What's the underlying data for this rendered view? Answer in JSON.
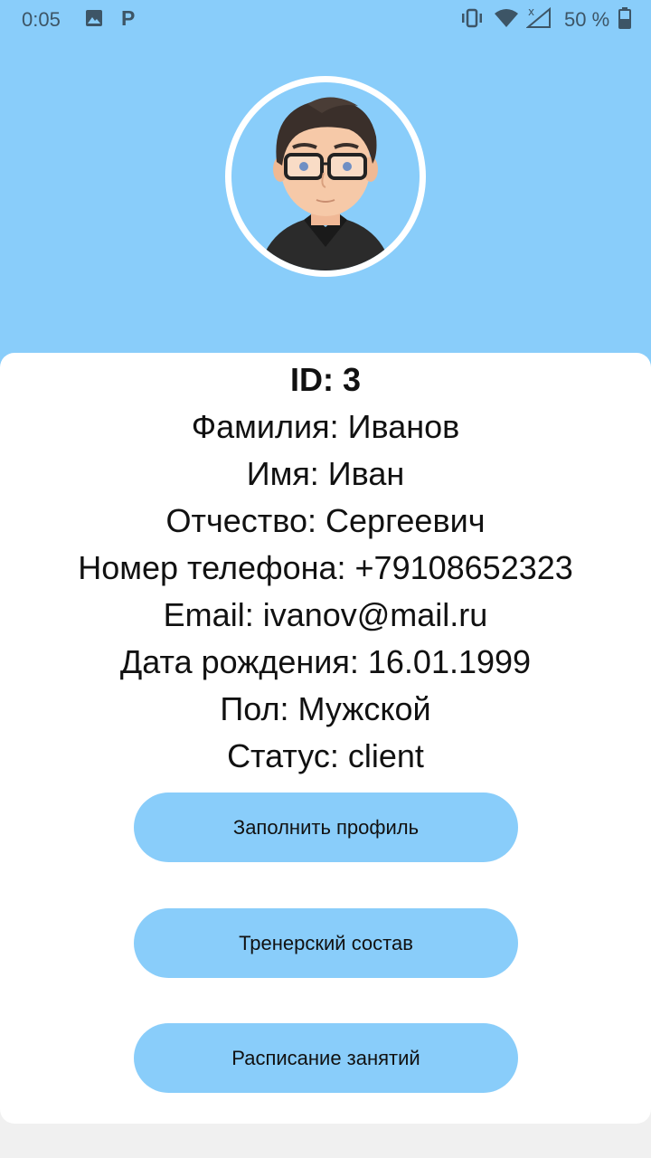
{
  "status_bar": {
    "time": "0:05",
    "battery_text": "50 %",
    "icons": [
      "image-icon",
      "p-icon",
      "vibrate-icon",
      "wifi-icon",
      "signal-icon",
      "battery-icon"
    ]
  },
  "colors": {
    "accent": "#89cdfa",
    "card": "#ffffff",
    "text": "#111111"
  },
  "profile": {
    "id": "ID: 3",
    "last_name": "Фамилия: Иванов",
    "first_name": "Имя: Иван",
    "patronymic": "Отчество: Сергеевич",
    "phone": "Номер телефона: +79108652323",
    "email": "Email: ivanov@mail.ru",
    "birth_date": "Дата рождения: 16.01.1999",
    "gender": "Пол: Мужской",
    "status": "Статус: client"
  },
  "buttons": {
    "fill_profile": "Заполнить профиль",
    "trainers": "Тренерский состав",
    "schedule": "Расписание занятий"
  }
}
